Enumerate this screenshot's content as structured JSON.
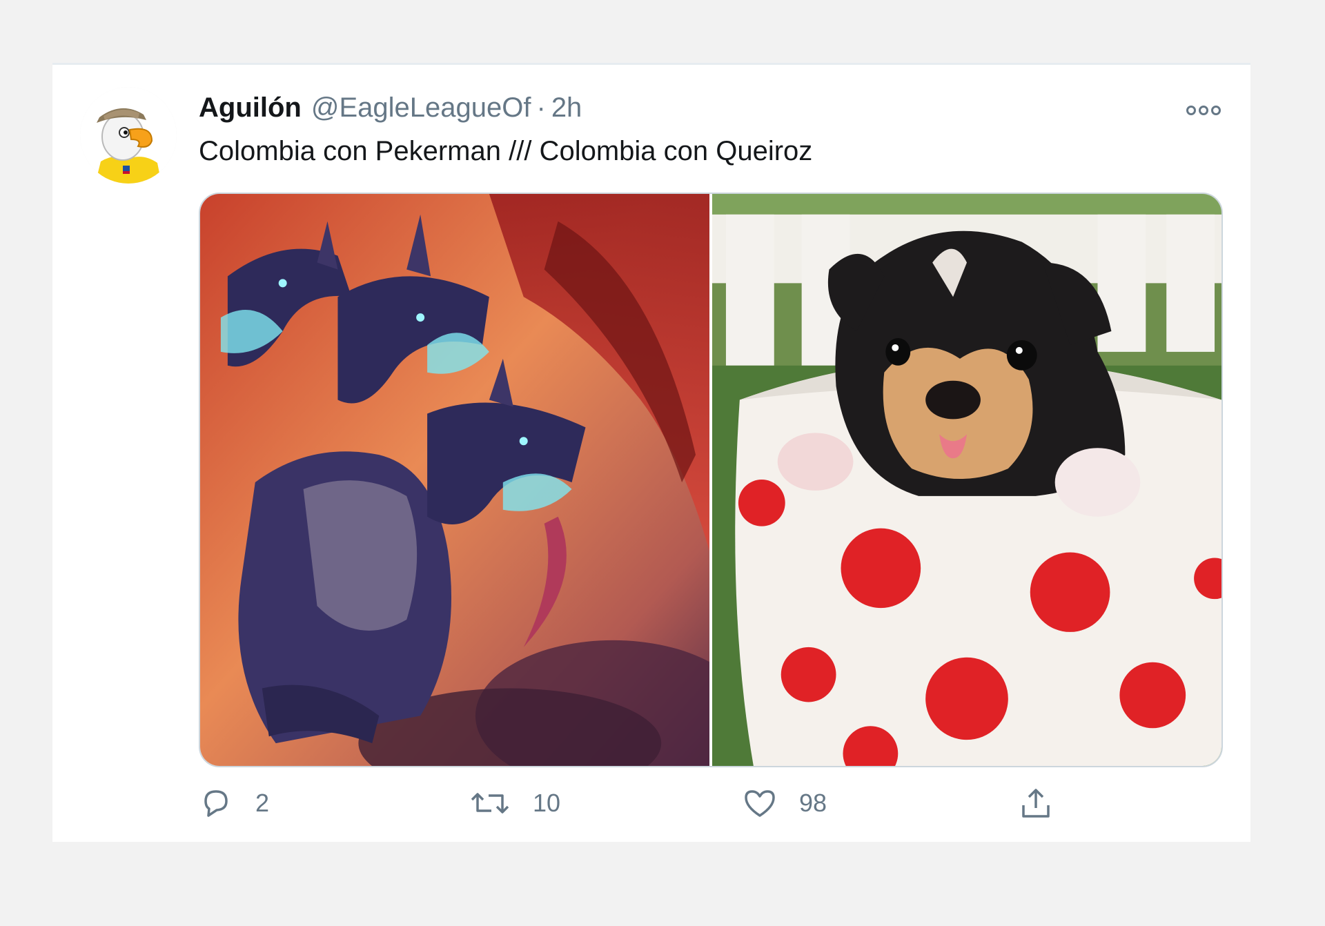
{
  "tweet": {
    "author": {
      "display_name": "Aguilón",
      "handle": "@EagleLeagueOf",
      "avatar_icon": "eagle-mascot-avatar"
    },
    "separator": "·",
    "time": "2h",
    "more_icon": "more-options-icon",
    "text": "Colombia con Pekerman /// Colombia con Queiroz",
    "media": [
      {
        "icon": "three-headed-dragon-image"
      },
      {
        "icon": "puppy-in-polka-dot-cup-image"
      }
    ],
    "actions": {
      "reply": {
        "icon": "reply-icon",
        "count": "2"
      },
      "retweet": {
        "icon": "retweet-icon",
        "count": "10"
      },
      "like": {
        "icon": "heart-icon",
        "count": "98"
      },
      "share": {
        "icon": "share-icon"
      }
    }
  },
  "colors": {
    "page_background": "#f2f2f2",
    "card_background": "#ffffff",
    "primary_text": "#14171a",
    "secondary_text": "#657786",
    "border": "#ccd6dd"
  }
}
